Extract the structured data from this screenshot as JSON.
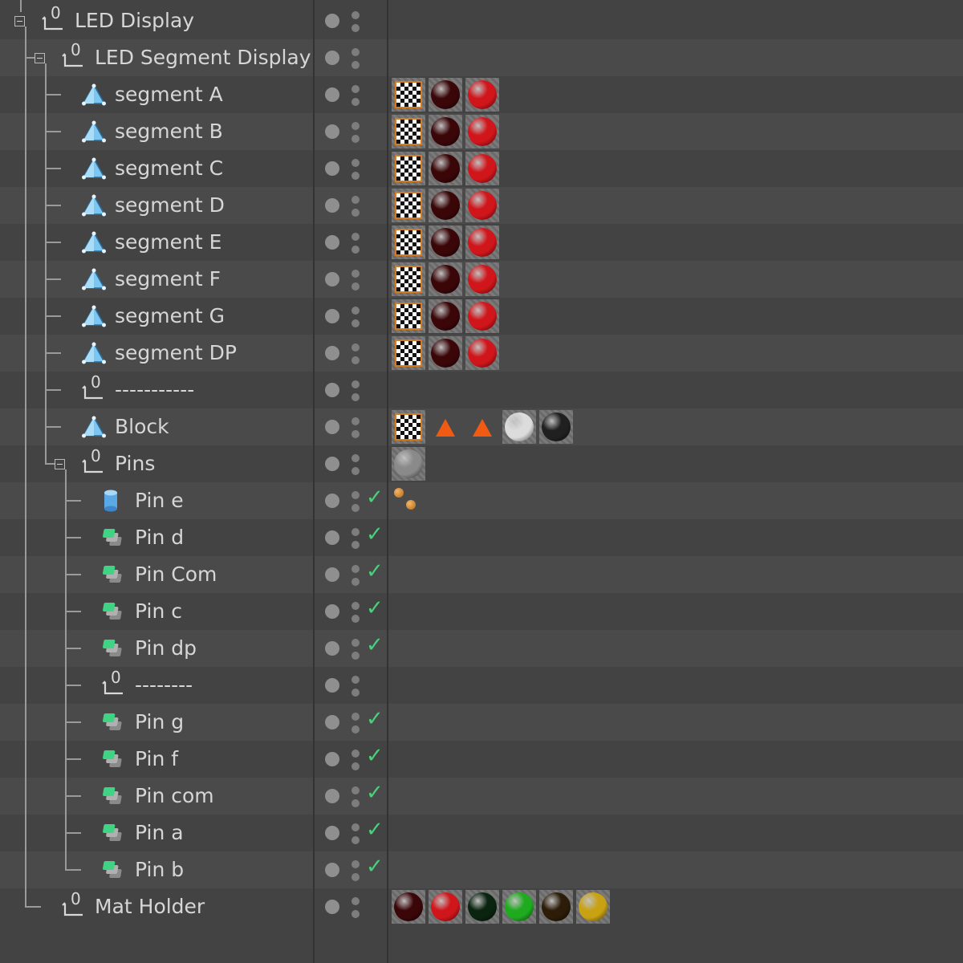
{
  "rows": [
    {
      "label": "LED Display",
      "indent": 0,
      "icon": "null-object-icon",
      "expander": true,
      "check": false,
      "tags": []
    },
    {
      "label": "LED Segment Display",
      "indent": 1,
      "icon": "null-object-icon",
      "expander": true,
      "check": false,
      "tags": []
    },
    {
      "label": "segment A",
      "indent": 2,
      "icon": "polygon-object-icon",
      "expander": false,
      "check": false,
      "tags": [
        "checker",
        "dark-red",
        "red"
      ]
    },
    {
      "label": "segment B",
      "indent": 2,
      "icon": "polygon-object-icon",
      "expander": false,
      "check": false,
      "tags": [
        "checker",
        "dark-red",
        "red"
      ]
    },
    {
      "label": "segment C",
      "indent": 2,
      "icon": "polygon-object-icon",
      "expander": false,
      "check": false,
      "tags": [
        "checker",
        "dark-red",
        "red"
      ]
    },
    {
      "label": "segment D",
      "indent": 2,
      "icon": "polygon-object-icon",
      "expander": false,
      "check": false,
      "tags": [
        "checker",
        "dark-red",
        "red"
      ]
    },
    {
      "label": "segment E",
      "indent": 2,
      "icon": "polygon-object-icon",
      "expander": false,
      "check": false,
      "tags": [
        "checker",
        "dark-red",
        "red"
      ]
    },
    {
      "label": "segment F",
      "indent": 2,
      "icon": "polygon-object-icon",
      "expander": false,
      "check": false,
      "tags": [
        "checker",
        "dark-red",
        "red"
      ]
    },
    {
      "label": "segment G",
      "indent": 2,
      "icon": "polygon-object-icon",
      "expander": false,
      "check": false,
      "tags": [
        "checker",
        "dark-red",
        "red"
      ]
    },
    {
      "label": "segment DP",
      "indent": 2,
      "icon": "polygon-object-icon",
      "expander": false,
      "check": false,
      "tags": [
        "checker",
        "dark-red",
        "red"
      ]
    },
    {
      "label": "-----------",
      "indent": 2,
      "icon": "null-object-icon",
      "expander": false,
      "check": false,
      "tags": []
    },
    {
      "label": "Block",
      "indent": 2,
      "icon": "polygon-object-icon",
      "expander": false,
      "check": false,
      "tags": [
        "checker",
        "orange-triangle",
        "orange-triangle",
        "white",
        "black"
      ]
    },
    {
      "label": "Pins",
      "indent": 2,
      "icon": "null-object-icon",
      "expander": true,
      "check": false,
      "tags": [
        "chrome"
      ]
    },
    {
      "label": "Pin e",
      "indent": 3,
      "icon": "cylinder-icon",
      "expander": false,
      "check": true,
      "tags": [
        "orange-dots"
      ]
    },
    {
      "label": "Pin d",
      "indent": 3,
      "icon": "instance-icon",
      "expander": false,
      "check": true,
      "tags": []
    },
    {
      "label": "Pin Com",
      "indent": 3,
      "icon": "instance-icon",
      "expander": false,
      "check": true,
      "tags": []
    },
    {
      "label": "Pin c",
      "indent": 3,
      "icon": "instance-icon",
      "expander": false,
      "check": true,
      "tags": []
    },
    {
      "label": "Pin dp",
      "indent": 3,
      "icon": "instance-icon",
      "expander": false,
      "check": true,
      "tags": []
    },
    {
      "label": "--------",
      "indent": 3,
      "icon": "null-object-icon",
      "expander": false,
      "check": false,
      "tags": []
    },
    {
      "label": "Pin g",
      "indent": 3,
      "icon": "instance-icon",
      "expander": false,
      "check": true,
      "tags": []
    },
    {
      "label": "Pin f",
      "indent": 3,
      "icon": "instance-icon",
      "expander": false,
      "check": true,
      "tags": []
    },
    {
      "label": "Pin com",
      "indent": 3,
      "icon": "instance-icon",
      "expander": false,
      "check": true,
      "tags": []
    },
    {
      "label": "Pin a",
      "indent": 3,
      "icon": "instance-icon",
      "expander": false,
      "check": true,
      "tags": []
    },
    {
      "label": "Pin b",
      "indent": 3,
      "icon": "instance-icon",
      "expander": false,
      "check": true,
      "tags": []
    },
    {
      "label": "Mat Holder",
      "indent": 1,
      "icon": "null-object-icon",
      "expander": false,
      "check": false,
      "tags": [
        "dark-red",
        "red",
        "dark-green",
        "green",
        "dark-brown",
        "yellow"
      ]
    }
  ],
  "null_icon_digit": "0",
  "check_glyph": "✓",
  "colors": {
    "row_a": "#434343",
    "row_b": "#4a4a4a",
    "text": "#d6d6d6",
    "check": "#49d17c",
    "poly_icon": "#7cc6f2",
    "instance_icon": "#3fd483",
    "checker_border": "#d47a23"
  },
  "material_colors": {
    "dark-red": "#3a0608",
    "red": "#d0161b",
    "dark-green": "#0a2410",
    "green": "#1faa1f",
    "dark-brown": "#2c1c08",
    "yellow": "#c9a214",
    "white": "#dcdcdc",
    "black": "#202020",
    "chrome": "#8a8a8a"
  }
}
